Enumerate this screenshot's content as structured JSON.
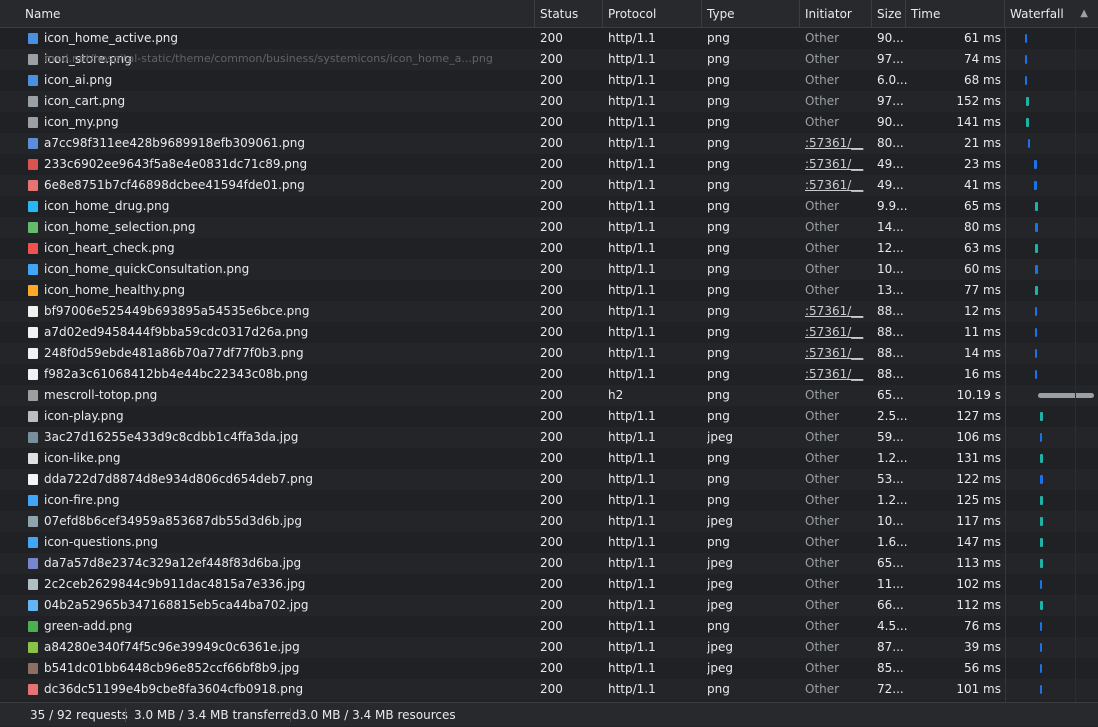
{
  "header": {
    "name": "Name",
    "status": "Status",
    "protocol": "Protocol",
    "type": "Type",
    "initiator": "Initiator",
    "size": "Size",
    "time": "Time",
    "waterfall": "Waterfall",
    "sort_icon": "sort-triangle-icon"
  },
  "hover_url": "med.net/hospital-static/theme/common/business/systemicons/icon_home_a...png",
  "rows": [
    {
      "name": "icon_home_active.png",
      "status": "200",
      "protocol": "http/1.1",
      "type": "png",
      "initiator": "Other",
      "size": "90...",
      "time": "61 ms",
      "icon_color": "#4a90e2"
    },
    {
      "name": "icon_store.png",
      "status": "200",
      "protocol": "http/1.1",
      "type": "png",
      "initiator": "Other",
      "size": "97...",
      "time": "74 ms",
      "icon_color": "#9aa0a6"
    },
    {
      "name": "icon_ai.png",
      "status": "200",
      "protocol": "http/1.1",
      "type": "png",
      "initiator": "Other",
      "size": "6.0...",
      "time": "68 ms",
      "icon_color": "#4a90e2"
    },
    {
      "name": "icon_cart.png",
      "status": "200",
      "protocol": "http/1.1",
      "type": "png",
      "initiator": "Other",
      "size": "97...",
      "time": "152 ms",
      "icon_color": "#9aa0a6"
    },
    {
      "name": "icon_my.png",
      "status": "200",
      "protocol": "http/1.1",
      "type": "png",
      "initiator": "Other",
      "size": "90...",
      "time": "141 ms",
      "icon_color": "#9aa0a6"
    },
    {
      "name": "a7cc98f311ee428b9689918efb309061.png",
      "status": "200",
      "protocol": "http/1.1",
      "type": "png",
      "initiator": ":57361/__",
      "size": "80...",
      "time": "21 ms",
      "icon_color": "#5c8dd6"
    },
    {
      "name": "233c6902ee9643f5a8e4e0831dc71c89.png",
      "status": "200",
      "protocol": "http/1.1",
      "type": "png",
      "initiator": ":57361/__",
      "size": "49...",
      "time": "23 ms",
      "icon_color": "#d9534f"
    },
    {
      "name": "6e8e8751b7cf46898dcbee41594fde01.png",
      "status": "200",
      "protocol": "http/1.1",
      "type": "png",
      "initiator": ":57361/__",
      "size": "49...",
      "time": "41 ms",
      "icon_color": "#e57373"
    },
    {
      "name": "icon_home_drug.png",
      "status": "200",
      "protocol": "http/1.1",
      "type": "png",
      "initiator": "Other",
      "size": "9.9...",
      "time": "65 ms",
      "icon_color": "#29b6f6"
    },
    {
      "name": "icon_home_selection.png",
      "status": "200",
      "protocol": "http/1.1",
      "type": "png",
      "initiator": "Other",
      "size": "14...",
      "time": "80 ms",
      "icon_color": "#66bb6a"
    },
    {
      "name": "icon_heart_check.png",
      "status": "200",
      "protocol": "http/1.1",
      "type": "png",
      "initiator": "Other",
      "size": "12...",
      "time": "63 ms",
      "icon_color": "#ef5350"
    },
    {
      "name": "icon_home_quickConsultation.png",
      "status": "200",
      "protocol": "http/1.1",
      "type": "png",
      "initiator": "Other",
      "size": "10...",
      "time": "60 ms",
      "icon_color": "#42a5f5"
    },
    {
      "name": "icon_home_healthy.png",
      "status": "200",
      "protocol": "http/1.1",
      "type": "png",
      "initiator": "Other",
      "size": "13...",
      "time": "77 ms",
      "icon_color": "#ffa726"
    },
    {
      "name": "bf97006e525449b693895a54535e6bce.png",
      "status": "200",
      "protocol": "http/1.1",
      "type": "png",
      "initiator": ":57361/__",
      "size": "88...",
      "time": "12 ms",
      "icon_color": "#f1f1f1"
    },
    {
      "name": "a7d02ed9458444f9bba59cdc0317d26a.png",
      "status": "200",
      "protocol": "http/1.1",
      "type": "png",
      "initiator": ":57361/__",
      "size": "88...",
      "time": "11 ms",
      "icon_color": "#f1f1f1"
    },
    {
      "name": "248f0d59ebde481a86b70a77df77f0b3.png",
      "status": "200",
      "protocol": "http/1.1",
      "type": "png",
      "initiator": ":57361/__",
      "size": "88...",
      "time": "14 ms",
      "icon_color": "#f1f1f1"
    },
    {
      "name": "f982a3c61068412bb4e44bc22343c08b.png",
      "status": "200",
      "protocol": "http/1.1",
      "type": "png",
      "initiator": ":57361/__",
      "size": "88...",
      "time": "16 ms",
      "icon_color": "#f1f1f1"
    },
    {
      "name": "mescroll-totop.png",
      "status": "200",
      "protocol": "h2",
      "type": "png",
      "initiator": "Other",
      "size": "65...",
      "time": "10.19 s",
      "icon_color": "#9e9e9e"
    },
    {
      "name": "icon-play.png",
      "status": "200",
      "protocol": "http/1.1",
      "type": "png",
      "initiator": "Other",
      "size": "2.5...",
      "time": "127 ms",
      "icon_color": "#bdbdbd"
    },
    {
      "name": "3ac27d16255e433d9c8cdbb1c4ffa3da.jpg",
      "status": "200",
      "protocol": "http/1.1",
      "type": "jpeg",
      "initiator": "Other",
      "size": "59...",
      "time": "106 ms",
      "icon_color": "#78909c"
    },
    {
      "name": "icon-like.png",
      "status": "200",
      "protocol": "http/1.1",
      "type": "png",
      "initiator": "Other",
      "size": "1.2...",
      "time": "131 ms",
      "icon_color": "#e0e0e0"
    },
    {
      "name": "dda722d7d8874d8e934d806cd654deb7.png",
      "status": "200",
      "protocol": "http/1.1",
      "type": "png",
      "initiator": "Other",
      "size": "53...",
      "time": "122 ms",
      "icon_color": "#f5f5f5"
    },
    {
      "name": "icon-fire.png",
      "status": "200",
      "protocol": "http/1.1",
      "type": "png",
      "initiator": "Other",
      "size": "1.2...",
      "time": "125 ms",
      "icon_color": "#42a5f5"
    },
    {
      "name": "07efd8b6cef34959a853687db55d3d6b.jpg",
      "status": "200",
      "protocol": "http/1.1",
      "type": "jpeg",
      "initiator": "Other",
      "size": "10...",
      "time": "117 ms",
      "icon_color": "#90a4ae"
    },
    {
      "name": "icon-questions.png",
      "status": "200",
      "protocol": "http/1.1",
      "type": "png",
      "initiator": "Other",
      "size": "1.6...",
      "time": "147 ms",
      "icon_color": "#42a5f5"
    },
    {
      "name": "da7a57d8e2374c329a12ef448f83d6ba.jpg",
      "status": "200",
      "protocol": "http/1.1",
      "type": "jpeg",
      "initiator": "Other",
      "size": "65...",
      "time": "113 ms",
      "icon_color": "#7986cb"
    },
    {
      "name": "2c2ceb2629844c9b911dac4815a7e336.jpg",
      "status": "200",
      "protocol": "http/1.1",
      "type": "jpeg",
      "initiator": "Other",
      "size": "11...",
      "time": "102 ms",
      "icon_color": "#b0bec5"
    },
    {
      "name": "04b2a52965b347168815eb5ca44ba702.jpg",
      "status": "200",
      "protocol": "http/1.1",
      "type": "jpeg",
      "initiator": "Other",
      "size": "66...",
      "time": "112 ms",
      "icon_color": "#64b5f6"
    },
    {
      "name": "green-add.png",
      "status": "200",
      "protocol": "http/1.1",
      "type": "png",
      "initiator": "Other",
      "size": "4.5...",
      "time": "76 ms",
      "icon_color": "#4caf50"
    },
    {
      "name": "a84280e340f74f5c96e39949c0c6361e.jpg",
      "status": "200",
      "protocol": "http/1.1",
      "type": "jpeg",
      "initiator": "Other",
      "size": "87...",
      "time": "39 ms",
      "icon_color": "#8bc34a"
    },
    {
      "name": "b541dc01bb6448cb96e852ccf66bf8b9.jpg",
      "status": "200",
      "protocol": "http/1.1",
      "type": "jpeg",
      "initiator": "Other",
      "size": "85...",
      "time": "56 ms",
      "icon_color": "#8d6e63"
    },
    {
      "name": "dc36dc51199e4b9cbe8fa3604cfb0918.png",
      "status": "200",
      "protocol": "http/1.1",
      "type": "png",
      "initiator": "Other",
      "size": "72...",
      "time": "101 ms",
      "icon_color": "#e57373"
    }
  ],
  "waterfall_colors": {
    "blue": "#1a73e8",
    "teal": "#1fb3a8",
    "gray": "#9aa0a6"
  },
  "footer": {
    "requests": "35 / 92 requests",
    "transferred": "3.0 MB / 3.4 MB transferred",
    "resources": "3.0 MB / 3.4 MB resources"
  }
}
